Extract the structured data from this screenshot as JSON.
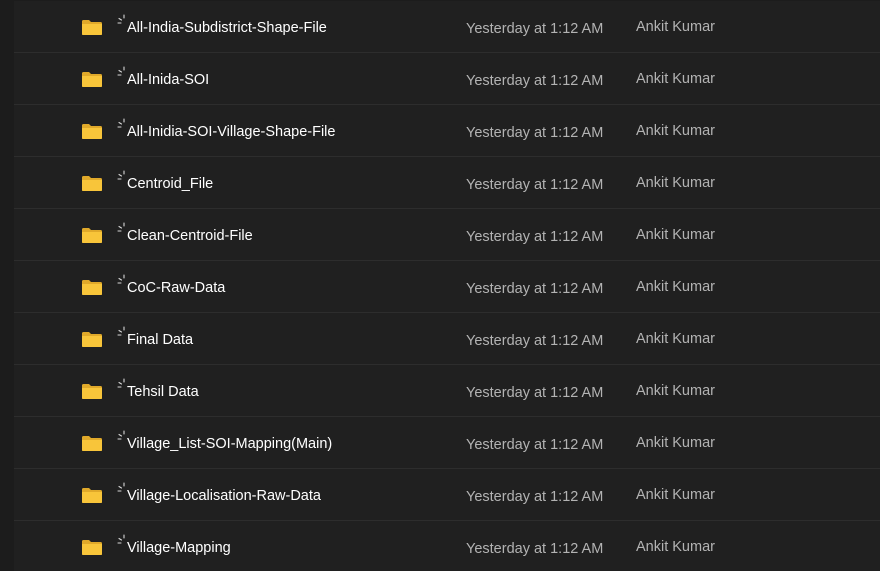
{
  "files": [
    {
      "name": "All-India-Subdistrict-Shape-File",
      "modified": "Yesterday at 1:12 AM",
      "owner": "Ankit Kumar",
      "icon": "folder-icon",
      "status_icon": "sync-pending-icon"
    },
    {
      "name": "All-Inida-SOI",
      "modified": "Yesterday at 1:12 AM",
      "owner": "Ankit Kumar",
      "icon": "folder-icon",
      "status_icon": "sync-pending-icon"
    },
    {
      "name": "All-Inidia-SOI-Village-Shape-File",
      "modified": "Yesterday at 1:12 AM",
      "owner": "Ankit Kumar",
      "icon": "folder-icon",
      "status_icon": "sync-pending-icon"
    },
    {
      "name": "Centroid_File",
      "modified": "Yesterday at 1:12 AM",
      "owner": "Ankit Kumar",
      "icon": "folder-icon",
      "status_icon": "sync-pending-icon"
    },
    {
      "name": "Clean-Centroid-File",
      "modified": "Yesterday at 1:12 AM",
      "owner": "Ankit Kumar",
      "icon": "folder-icon",
      "status_icon": "sync-pending-icon"
    },
    {
      "name": "CoC-Raw-Data",
      "modified": "Yesterday at 1:12 AM",
      "owner": "Ankit Kumar",
      "icon": "folder-icon",
      "status_icon": "sync-pending-icon"
    },
    {
      "name": "Final Data",
      "modified": "Yesterday at 1:12 AM",
      "owner": "Ankit Kumar",
      "icon": "folder-icon",
      "status_icon": "sync-pending-icon"
    },
    {
      "name": "Tehsil Data",
      "modified": "Yesterday at 1:12 AM",
      "owner": "Ankit Kumar",
      "icon": "folder-icon",
      "status_icon": "sync-pending-icon"
    },
    {
      "name": "Village_List-SOI-Mapping(Main)",
      "modified": "Yesterday at 1:12 AM",
      "owner": "Ankit Kumar",
      "icon": "folder-icon",
      "status_icon": "sync-pending-icon"
    },
    {
      "name": "Village-Localisation-Raw-Data",
      "modified": "Yesterday at 1:12 AM",
      "owner": "Ankit Kumar",
      "icon": "folder-icon",
      "status_icon": "sync-pending-icon"
    },
    {
      "name": "Village-Mapping",
      "modified": "Yesterday at 1:12 AM",
      "owner": "Ankit Kumar",
      "icon": "folder-icon",
      "status_icon": "sync-pending-icon"
    }
  ],
  "colors": {
    "background": "#1c1c1c",
    "row_background": "#202020",
    "row_divider": "#2d2d2d",
    "folder_yellow": "#f8c53a",
    "text_primary": "#ffffff",
    "text_secondary": "#b3b3b3"
  }
}
